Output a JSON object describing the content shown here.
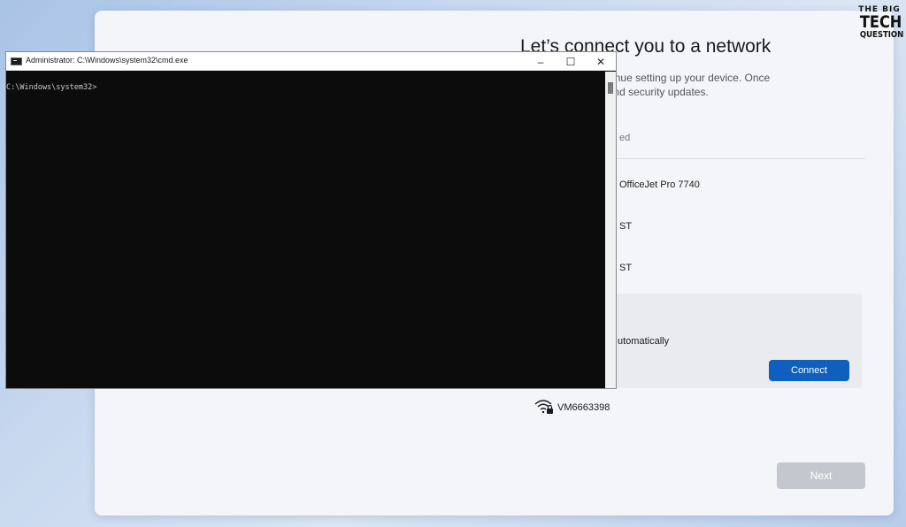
{
  "oobe": {
    "title": "Let’s connect you to a network",
    "description_line1": "t connection to continue setting up your device. Once",
    "description_line2": "the latest features and security updates.",
    "networks": [
      {
        "label": "ed",
        "style": "dim"
      },
      {
        "label": "OfficeJet Pro 7740",
        "style": "normal"
      },
      {
        "label": "ST",
        "style": "normal"
      },
      {
        "label": "ST",
        "style": "normal"
      }
    ],
    "expanded_network": {
      "auto_connect_label": "utomatically",
      "connect_label": "Connect"
    },
    "vm_network": {
      "name": "VM6663398",
      "icon": "wifi-secured-icon"
    },
    "next_label": "Next"
  },
  "cmd_window": {
    "title": "Administrator: C:\\Windows\\system32\\cmd.exe",
    "prompt": "C:\\Windows\\system32>",
    "controls": {
      "minimize": "–",
      "maximize": "☐",
      "close": "✕"
    }
  },
  "logo": {
    "line1": "THE BIG",
    "line2": "TECH",
    "line3": "QUESTION"
  },
  "colors": {
    "accent": "#0f5fbe",
    "terminal_bg": "#0c0c0c",
    "disabled_button": "#c4c8ce"
  }
}
